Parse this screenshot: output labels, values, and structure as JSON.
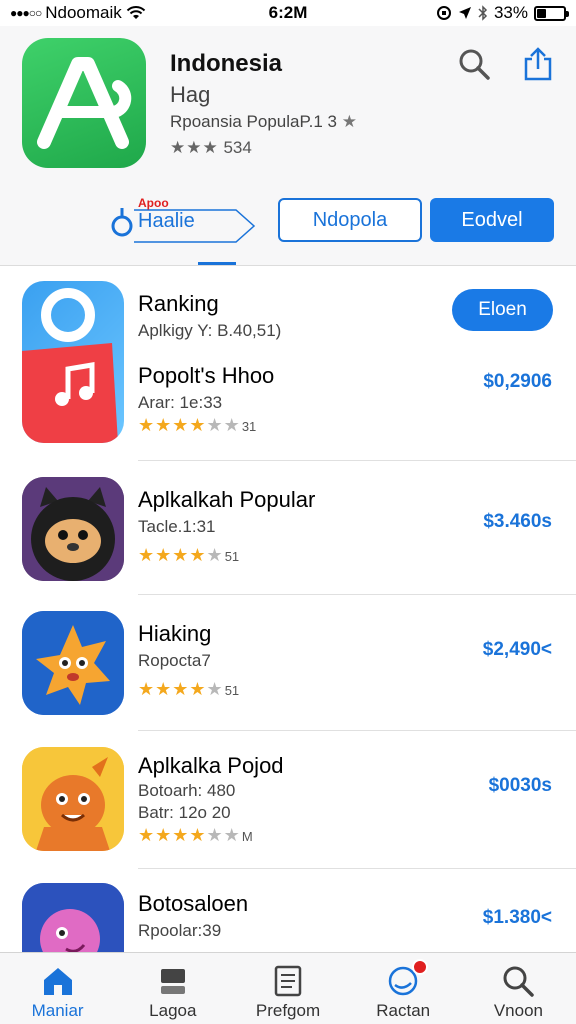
{
  "status_bar": {
    "carrier": "Ndoomaik",
    "time": "6:2M",
    "battery": "33%",
    "battery_level": 0.33
  },
  "app": {
    "title": "Indonesia",
    "subtitle": "Hag",
    "category": "Rpoansia PopulaP.1 3",
    "rating_count": "534",
    "icon": "app-a-icon",
    "accent": "#1fa84a"
  },
  "segments": {
    "first_small": "Apoo",
    "first_label": "Haalie",
    "second_label": "Ndopola",
    "third_label": "Eodvel"
  },
  "rows": [
    {
      "title": "Ranking",
      "sub": "Aplkigy Y: B.40,51)",
      "title2": "Popolt's Hhoo",
      "sub2": "Arar: 1e:33",
      "stars": 4,
      "count": "31",
      "price": "$0,2906",
      "button": "Eloen",
      "icon": "music-app-icon"
    },
    {
      "title": "Aplkalkah Popular",
      "sub": "Tacle.1:31",
      "stars": 4,
      "count": "51",
      "price": "$3.460s",
      "icon": "bear-character-icon"
    },
    {
      "title": "Hiaking",
      "sub": "Ropocta7",
      "stars": 4,
      "count": "51",
      "price": "$2,490<",
      "icon": "star-character-icon"
    },
    {
      "title": "Aplkalka Pojod",
      "sub": "Botoarh: 480",
      "sub2": "Batr: 12o 20",
      "stars": 4,
      "count": "M",
      "price": "$0030s",
      "icon": "orange-monster-icon"
    },
    {
      "title": "Botosaloen",
      "sub": "Rpoolar:39",
      "price": "$1.380<",
      "icon": "pink-creature-icon"
    }
  ],
  "tabs": [
    {
      "label": "Maniar",
      "icon": "home-icon",
      "active": true
    },
    {
      "label": "Lagoa",
      "icon": "stack-icon",
      "active": false
    },
    {
      "label": "Prefgom",
      "icon": "document-icon",
      "active": false
    },
    {
      "label": "Ractan",
      "icon": "updates-icon",
      "active": false
    },
    {
      "label": "Vnoon",
      "icon": "search-icon",
      "active": false
    }
  ]
}
